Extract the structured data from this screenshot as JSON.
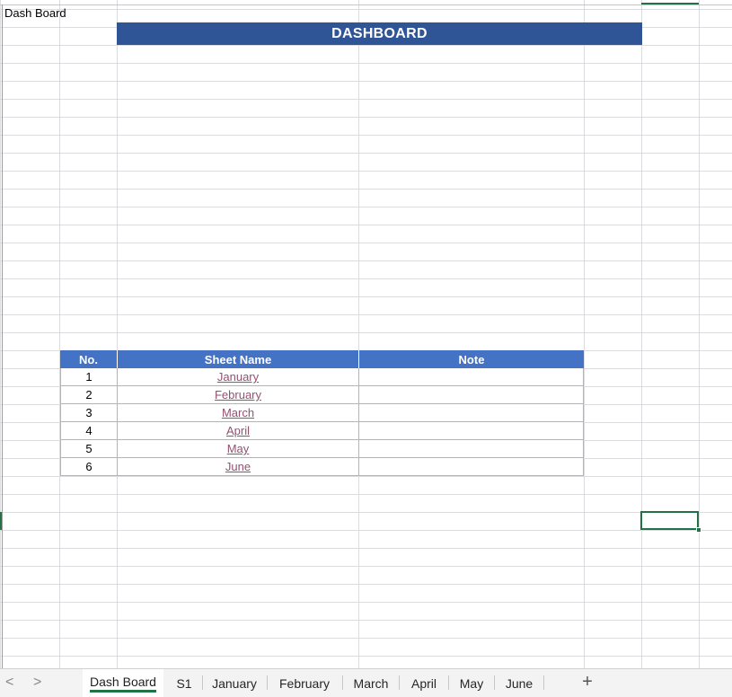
{
  "cell_a1": "Dash Board",
  "banner_title": "DASHBOARD",
  "table": {
    "headers": [
      "No.",
      "Sheet Name",
      "Note"
    ],
    "rows": [
      {
        "no": "1",
        "name": "January",
        "note": ""
      },
      {
        "no": "2",
        "name": "February",
        "note": ""
      },
      {
        "no": "3",
        "name": "March",
        "note": ""
      },
      {
        "no": "4",
        "name": "April",
        "note": ""
      },
      {
        "no": "5",
        "name": "May",
        "note": ""
      },
      {
        "no": "6",
        "name": "June",
        "note": ""
      }
    ]
  },
  "sheet_tabs": [
    "Dash Board",
    "S1",
    "January",
    "February",
    "March",
    "April",
    "May",
    "June"
  ],
  "active_tab": "Dash Board",
  "add_sheet_label": "+",
  "nav": {
    "prev": "<",
    "next": ">"
  },
  "colors": {
    "banner": "#2f5597",
    "header": "#4472c4",
    "link": "#954f72",
    "selection": "#217346"
  }
}
